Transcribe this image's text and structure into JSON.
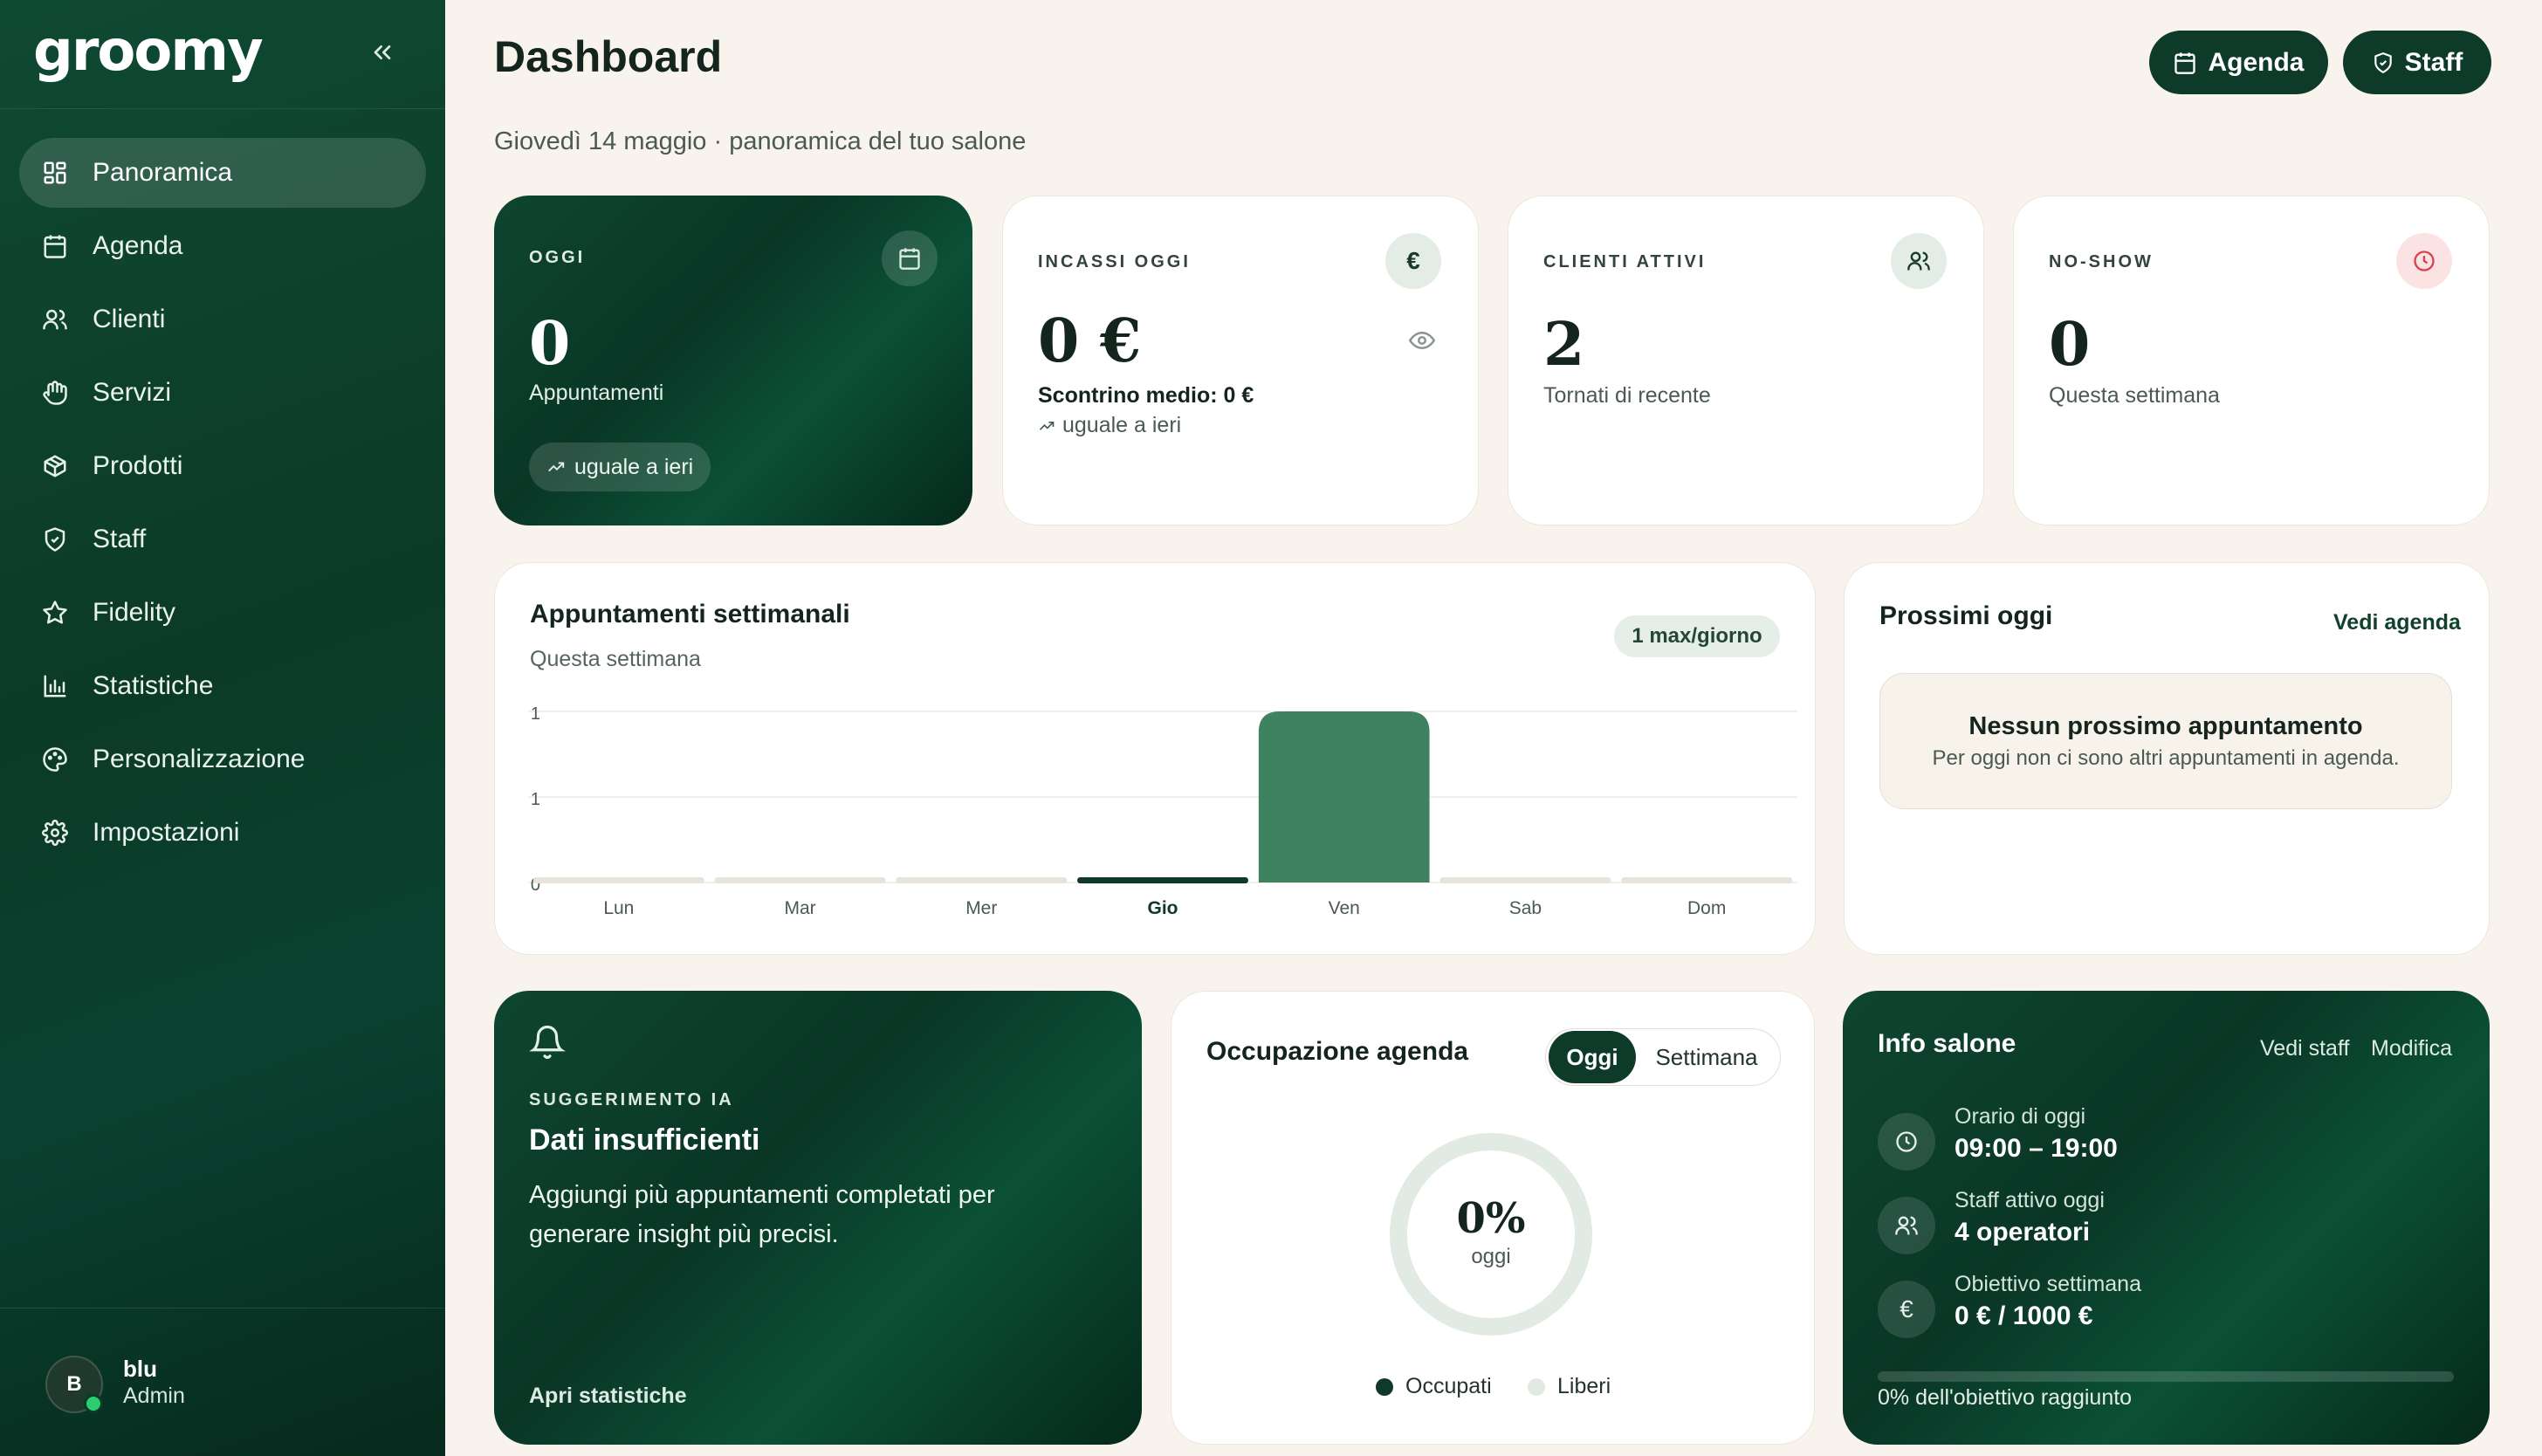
{
  "app": {
    "logo": "groomy"
  },
  "sidebar": {
    "items": [
      {
        "label": "Panoramica",
        "icon": "grid-icon",
        "active": true
      },
      {
        "label": "Agenda",
        "icon": "calendar-icon"
      },
      {
        "label": "Clienti",
        "icon": "user-icon"
      },
      {
        "label": "Servizi",
        "icon": "hand-icon"
      },
      {
        "label": "Prodotti",
        "icon": "box-icon"
      },
      {
        "label": "Staff",
        "icon": "shield-icon"
      },
      {
        "label": "Fidelity",
        "icon": "star-icon"
      },
      {
        "label": "Statistiche",
        "icon": "bar-chart-icon"
      },
      {
        "label": "Personalizzazione",
        "icon": "palette-icon"
      },
      {
        "label": "Impostazioni",
        "icon": "gear-icon"
      }
    ],
    "user": {
      "initial": "B",
      "name": "blu",
      "role": "Admin"
    }
  },
  "header": {
    "title": "Dashboard",
    "subtitle": "Giovedì 14 maggio · panoramica del tuo salone",
    "agenda_button": "Agenda",
    "staff_button": "Staff"
  },
  "stats": {
    "oggi": {
      "label": "OGGI",
      "value": "0",
      "caption": "Appuntamenti",
      "trend": "uguale a ieri"
    },
    "incassi": {
      "label": "INCASSI OGGI",
      "value": "0 €",
      "scontrino": "Scontrino medio: 0 €",
      "trend": "uguale a ieri",
      "icon_glyph": "€"
    },
    "clienti": {
      "label": "CLIENTI ATTIVI",
      "value": "2",
      "caption": "Tornati di recente"
    },
    "noshow": {
      "label": "NO-SHOW",
      "value": "0",
      "caption": "Questa settimana"
    }
  },
  "weekly": {
    "title": "Appuntamenti settimanali",
    "subtitle": "Questa settimana",
    "badge": "1 max/giorno"
  },
  "chart_data": {
    "type": "bar",
    "categories": [
      "Lun",
      "Mar",
      "Mer",
      "Gio",
      "Ven",
      "Sab",
      "Dom"
    ],
    "values": [
      0,
      0,
      0,
      0,
      1,
      0,
      0
    ],
    "highlight": "Gio",
    "ylim": [
      0,
      1
    ],
    "y_ticks": [
      "0",
      "1",
      "1"
    ],
    "grid": true,
    "colors": {
      "bar": "#3f8260",
      "today": "#0d3a29",
      "empty": "#e8e4dc"
    }
  },
  "prossimi": {
    "title": "Prossimi oggi",
    "link": "Vedi agenda",
    "empty_title": "Nessun prossimo appuntamento",
    "empty_sub": "Per oggi non ci sono altri appuntamenti in agenda."
  },
  "ai": {
    "label": "SUGGERIMENTO IA",
    "title": "Dati insufficienti",
    "text": "Aggiungi più appuntamenti completati per generare insight più precisi.",
    "link": "Apri statistiche"
  },
  "occupazione": {
    "title": "Occupazione agenda",
    "tab_today": "Oggi",
    "tab_week": "Settimana",
    "value": "0%",
    "value_caption": "oggi",
    "legend_busy": "Occupati",
    "legend_free": "Liberi",
    "occupied_fraction": 0
  },
  "info": {
    "title": "Info salone",
    "link_staff": "Vedi staff",
    "link_edit": "Modifica",
    "orario_label": "Orario di oggi",
    "orario_value": "09:00 – 19:00",
    "staff_label": "Staff attivo oggi",
    "staff_value": "4 operatori",
    "obiettivo_label": "Obiettivo settimana",
    "obiettivo_value": "0 € / 1000 €",
    "progress_text": "0% dell'obiettivo raggiunto",
    "progress_fraction": 0
  }
}
